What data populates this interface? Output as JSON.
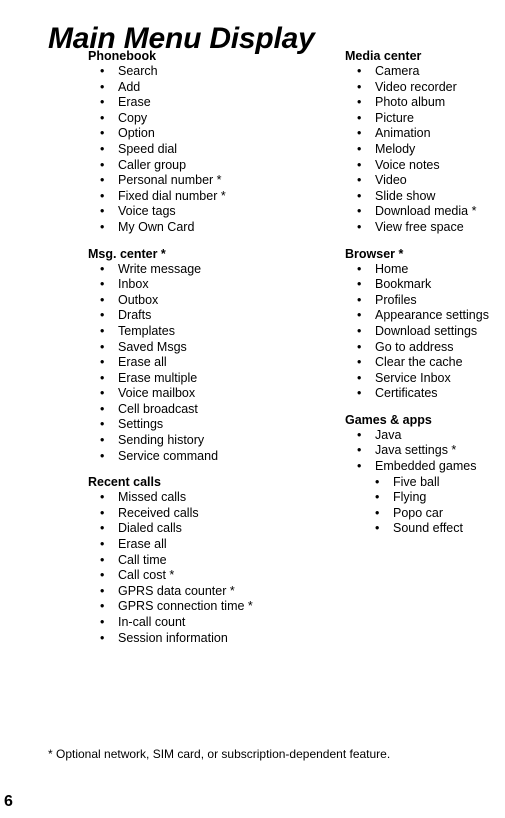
{
  "page": {
    "title": "Main Menu Display",
    "footnote": "* Optional network, SIM card, or subscription-dependent feature.",
    "page_number": "6",
    "bullet_glyph": "•"
  },
  "columns": {
    "left": [
      {
        "heading": "Phonebook",
        "items": [
          {
            "label": "Search"
          },
          {
            "label": "Add"
          },
          {
            "label": "Erase"
          },
          {
            "label": "Copy"
          },
          {
            "label": "Option"
          },
          {
            "label": "Speed dial"
          },
          {
            "label": "Caller group"
          },
          {
            "label": "Personal number *"
          },
          {
            "label": "Fixed dial number *"
          },
          {
            "label": "Voice tags"
          },
          {
            "label": "My Own Card"
          }
        ]
      },
      {
        "heading": "Msg. center *",
        "items": [
          {
            "label": "Write message"
          },
          {
            "label": "Inbox"
          },
          {
            "label": "Outbox"
          },
          {
            "label": "Drafts"
          },
          {
            "label": "Templates"
          },
          {
            "label": "Saved Msgs"
          },
          {
            "label": "Erase all"
          },
          {
            "label": "Erase multiple"
          },
          {
            "label": "Voice mailbox"
          },
          {
            "label": "Cell broadcast"
          },
          {
            "label": "Settings"
          },
          {
            "label": "Sending history"
          },
          {
            "label": "Service command"
          }
        ]
      },
      {
        "heading": "Recent calls",
        "items": [
          {
            "label": "Missed calls"
          },
          {
            "label": "Received calls"
          },
          {
            "label": "Dialed calls"
          },
          {
            "label": "Erase all"
          },
          {
            "label": "Call time"
          },
          {
            "label": "Call cost *"
          },
          {
            "label": "GPRS data counter *"
          },
          {
            "label": "GPRS connection time *"
          },
          {
            "label": "In-call count"
          },
          {
            "label": "Session information"
          }
        ]
      }
    ],
    "right": [
      {
        "heading": "Media center",
        "items": [
          {
            "label": "Camera"
          },
          {
            "label": "Video recorder"
          },
          {
            "label": "Photo album"
          },
          {
            "label": "Picture"
          },
          {
            "label": "Animation"
          },
          {
            "label": "Melody"
          },
          {
            "label": "Voice notes"
          },
          {
            "label": "Video"
          },
          {
            "label": "Slide show"
          },
          {
            "label": "Download media *"
          },
          {
            "label": "View free space"
          }
        ]
      },
      {
        "heading": "Browser *",
        "items": [
          {
            "label": "Home"
          },
          {
            "label": "Bookmark"
          },
          {
            "label": "Profiles"
          },
          {
            "label": "Appearance settings"
          },
          {
            "label": "Download settings"
          },
          {
            "label": "Go to address"
          },
          {
            "label": "Clear the cache"
          },
          {
            "label": "Service Inbox"
          },
          {
            "label": "Certificates"
          }
        ]
      },
      {
        "heading": "Games & apps",
        "items": [
          {
            "label": "Java"
          },
          {
            "label": "Java settings *"
          },
          {
            "label": "Embedded games",
            "sub_items": [
              {
                "label": "Five ball"
              },
              {
                "label": "Flying"
              },
              {
                "label": "Popo car"
              },
              {
                "label": "Sound effect"
              }
            ]
          }
        ]
      }
    ]
  }
}
